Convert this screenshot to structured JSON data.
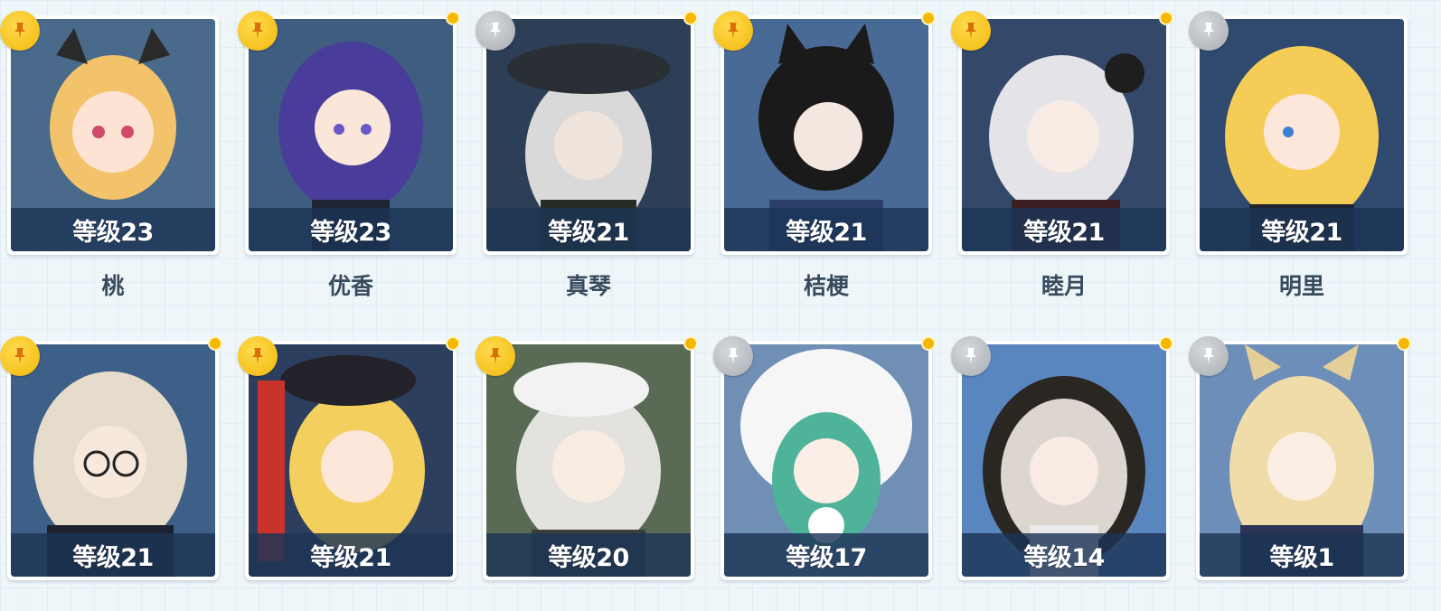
{
  "colors": {
    "pin_active": "#f2b80c",
    "pin_inactive": "#a9aeb3",
    "level_bar": "#1c3456",
    "notice_dot": "#f5b800"
  },
  "icons": {
    "pin": "pin-icon",
    "notice": "notice-dot"
  },
  "students": [
    {
      "level": "等级23",
      "name": "桃",
      "pinned": true,
      "dot": true
    },
    {
      "level": "等级23",
      "name": "优香",
      "pinned": true,
      "dot": true
    },
    {
      "level": "等级21",
      "name": "真琴",
      "pinned": false,
      "dot": true
    },
    {
      "level": "等级21",
      "name": "桔梗",
      "pinned": true,
      "dot": true
    },
    {
      "level": "等级21",
      "name": "睦月",
      "pinned": true,
      "dot": true
    },
    {
      "level": "等级21",
      "name": "明里",
      "pinned": false,
      "dot": false
    },
    {
      "level": "等级21",
      "name": "",
      "pinned": true,
      "dot": true
    },
    {
      "level": "等级21",
      "name": "",
      "pinned": true,
      "dot": true
    },
    {
      "level": "等级20",
      "name": "",
      "pinned": true,
      "dot": true
    },
    {
      "level": "等级17",
      "name": "",
      "pinned": false,
      "dot": true
    },
    {
      "level": "等级14",
      "name": "",
      "pinned": false,
      "dot": true
    },
    {
      "level": "等级1",
      "name": "",
      "pinned": false,
      "dot": true
    }
  ]
}
